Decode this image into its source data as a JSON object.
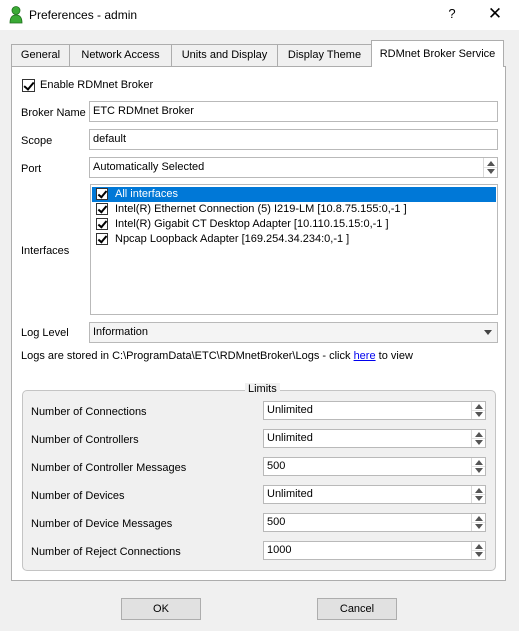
{
  "window": {
    "title": "Preferences - admin",
    "help_label": "?",
    "close_label": "✕"
  },
  "tabs": [
    {
      "label": "General"
    },
    {
      "label": "Network Access"
    },
    {
      "label": "Units and Display"
    },
    {
      "label": "Display Theme"
    },
    {
      "label": "RDMnet Broker Service",
      "active": true
    }
  ],
  "broker": {
    "enable_label": "Enable RDMnet Broker",
    "enable_checked": true,
    "name_label": "Broker Name",
    "name_value": "ETC RDMnet Broker",
    "scope_label": "Scope",
    "scope_value": "default",
    "port_label": "Port",
    "port_value": "Automatically Selected",
    "interfaces_label": "Interfaces",
    "interfaces": [
      {
        "label": "All interfaces",
        "checked": true,
        "selected": true
      },
      {
        "label": "Intel(R) Ethernet Connection (5) I219-LM [10.8.75.155:0,-1 ]",
        "checked": true
      },
      {
        "label": "Intel(R) Gigabit CT Desktop Adapter [10.110.15.15:0,-1 ]",
        "checked": true
      },
      {
        "label": "Npcap Loopback Adapter [169.254.34.234:0,-1 ]",
        "checked": true
      }
    ],
    "log_level_label": "Log Level",
    "log_level_value": "Information",
    "logs_note_prefix": "Logs are stored in C:\\ProgramData\\ETC\\RDMnetBroker\\Logs - click ",
    "logs_link": "here",
    "logs_note_suffix": " to view"
  },
  "limits": {
    "title": "Limits",
    "rows": [
      {
        "label": "Number of Connections",
        "value": "Unlimited"
      },
      {
        "label": "Number of Controllers",
        "value": "Unlimited"
      },
      {
        "label": "Number of Controller Messages",
        "value": "500"
      },
      {
        "label": "Number of Devices",
        "value": "Unlimited"
      },
      {
        "label": "Number of Device Messages",
        "value": "500"
      },
      {
        "label": "Number of Reject Connections",
        "value": "1000"
      }
    ]
  },
  "buttons": {
    "ok": "OK",
    "cancel": "Cancel"
  },
  "colors": {
    "selection": "#0078d7",
    "app_icon": "#2e9e2e"
  }
}
